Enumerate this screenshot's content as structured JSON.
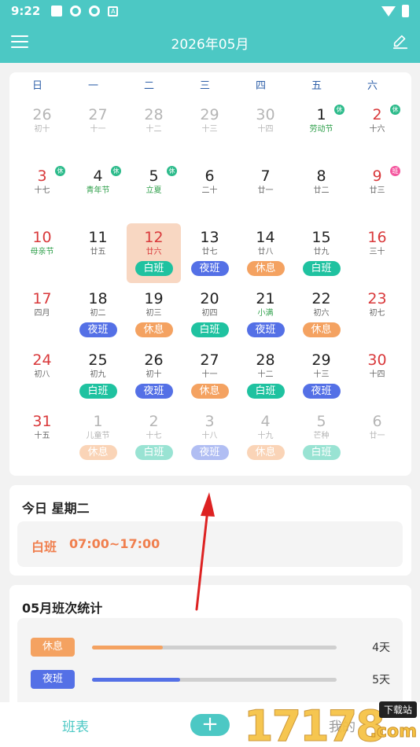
{
  "status_bar": {
    "time": "9:22"
  },
  "header": {
    "title": "2026年05月"
  },
  "weekdays": [
    "日",
    "一",
    "二",
    "三",
    "四",
    "五",
    "六"
  ],
  "shift_colors": {
    "休息": "#f4a261",
    "夜班": "#5470e6",
    "白班": "#1fc2a0"
  },
  "calendar": {
    "rows": [
      [
        {
          "d": "26",
          "l": "初十",
          "other": true
        },
        {
          "d": "27",
          "l": "十一",
          "other": true
        },
        {
          "d": "28",
          "l": "十二",
          "other": true
        },
        {
          "d": "29",
          "l": "十三",
          "other": true
        },
        {
          "d": "30",
          "l": "十四",
          "other": true
        },
        {
          "d": "1",
          "l": "劳动节",
          "festival": true,
          "badge": "休"
        },
        {
          "d": "2",
          "l": "十六",
          "weekend": true,
          "badge": "休"
        }
      ],
      [
        {
          "d": "3",
          "l": "十七",
          "weekend": true,
          "badge": "休"
        },
        {
          "d": "4",
          "l": "青年节",
          "festival": true,
          "badge": "休"
        },
        {
          "d": "5",
          "l": "立夏",
          "festival": true,
          "badge": "休"
        },
        {
          "d": "6",
          "l": "二十"
        },
        {
          "d": "7",
          "l": "廿一"
        },
        {
          "d": "8",
          "l": "廿二"
        },
        {
          "d": "9",
          "l": "廿三",
          "weekend": true,
          "badge": "班"
        }
      ],
      [
        {
          "d": "10",
          "l": "母亲节",
          "weekend": true,
          "festival": true
        },
        {
          "d": "11",
          "l": "廿五"
        },
        {
          "d": "12",
          "l": "廿六",
          "today": true,
          "shift": "白班"
        },
        {
          "d": "13",
          "l": "廿七",
          "shift": "夜班"
        },
        {
          "d": "14",
          "l": "廿八",
          "shift": "休息"
        },
        {
          "d": "15",
          "l": "廿九",
          "shift": "白班"
        },
        {
          "d": "16",
          "l": "三十",
          "weekend": true
        }
      ],
      [
        {
          "d": "17",
          "l": "四月",
          "weekend": true
        },
        {
          "d": "18",
          "l": "初二",
          "shift": "夜班"
        },
        {
          "d": "19",
          "l": "初三",
          "shift": "休息"
        },
        {
          "d": "20",
          "l": "初四",
          "shift": "白班"
        },
        {
          "d": "21",
          "l": "小满",
          "festival": true,
          "shift": "夜班"
        },
        {
          "d": "22",
          "l": "初六",
          "shift": "休息"
        },
        {
          "d": "23",
          "l": "初七",
          "weekend": true
        }
      ],
      [
        {
          "d": "24",
          "l": "初八",
          "weekend": true
        },
        {
          "d": "25",
          "l": "初九",
          "shift": "白班"
        },
        {
          "d": "26",
          "l": "初十",
          "shift": "夜班"
        },
        {
          "d": "27",
          "l": "十一",
          "shift": "休息"
        },
        {
          "d": "28",
          "l": "十二",
          "shift": "白班"
        },
        {
          "d": "29",
          "l": "十三",
          "shift": "夜班"
        },
        {
          "d": "30",
          "l": "十四",
          "weekend": true
        }
      ],
      [
        {
          "d": "31",
          "l": "十五",
          "weekend": true
        },
        {
          "d": "1",
          "l": "儿童节",
          "other": true,
          "shift": "休息"
        },
        {
          "d": "2",
          "l": "十七",
          "other": true,
          "shift": "白班"
        },
        {
          "d": "3",
          "l": "十八",
          "other": true,
          "shift": "夜班"
        },
        {
          "d": "4",
          "l": "十九",
          "other": true,
          "shift": "休息"
        },
        {
          "d": "5",
          "l": "芒种",
          "other": true,
          "shift": "白班"
        },
        {
          "d": "6",
          "l": "廿一",
          "other": true
        }
      ]
    ]
  },
  "today_card": {
    "title": "今日 星期二",
    "shift_name": "白班",
    "shift_time": "07:00~17:00"
  },
  "stats": {
    "title": "05月班次统计",
    "rows": [
      {
        "label": "休息",
        "count": "4天",
        "fraction": 0.29,
        "color": "#f4a261"
      },
      {
        "label": "夜班",
        "count": "5天",
        "fraction": 0.36,
        "color": "#5470e6"
      }
    ]
  },
  "bottom_bar": {
    "schedule_tab": "班表",
    "add_label": "+",
    "mine_tab": "我的"
  },
  "watermark": {
    "number": "17178",
    "tag": "下载站",
    "domain": ".com"
  }
}
